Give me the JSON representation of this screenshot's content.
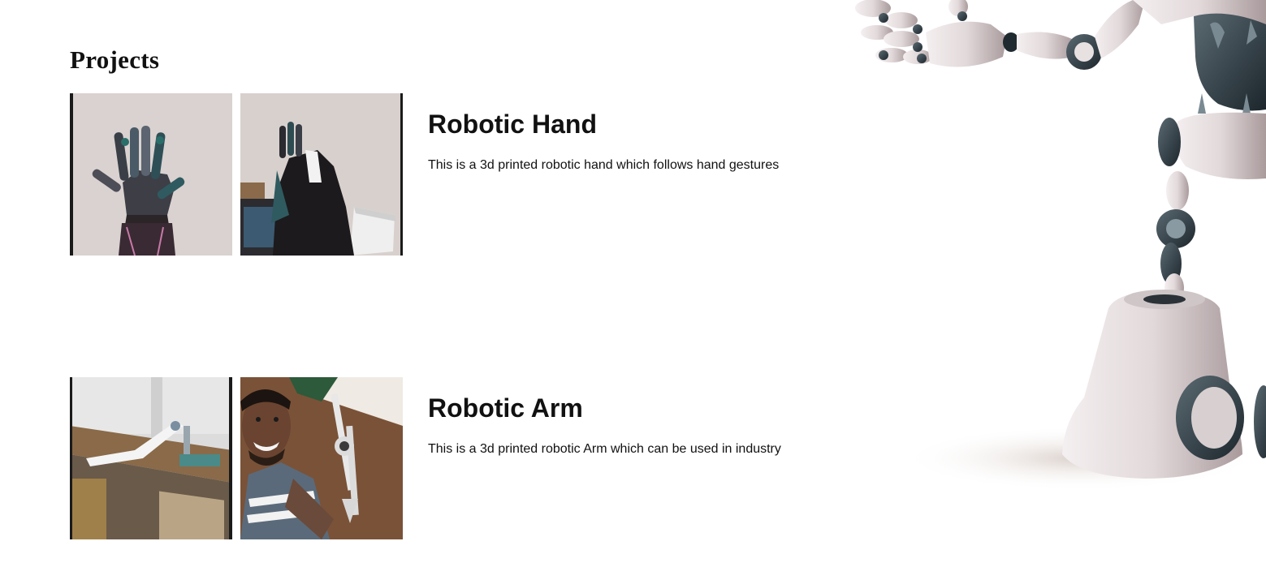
{
  "page": {
    "heading": "Projects"
  },
  "projects": [
    {
      "title": "Robotic Hand",
      "description": "This is a 3d printed robotic hand which follows hand gestures"
    },
    {
      "title": "Robotic Arm",
      "description": "This is a 3d printed robotic Arm which can be used in industry"
    }
  ],
  "colors": {
    "text": "#111111",
    "background": "#ffffff",
    "robot_body": "#e2dadb",
    "robot_joint": "#2c3a42"
  }
}
